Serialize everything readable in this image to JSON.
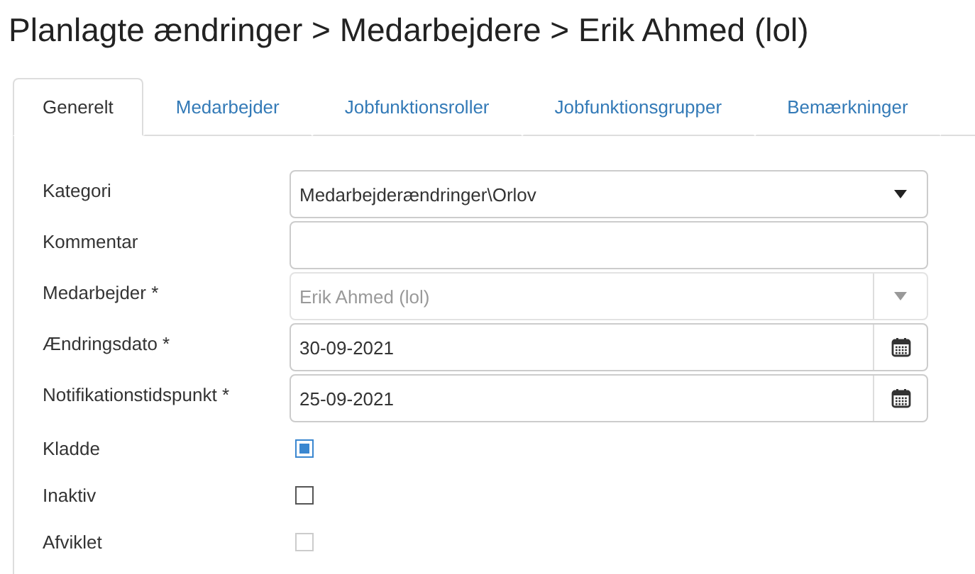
{
  "title": "Planlagte ændringer > Medarbejdere > Erik Ahmed (lol)",
  "tabs": [
    {
      "label": "Generelt",
      "selected": true
    },
    {
      "label": "Medarbejder",
      "selected": false
    },
    {
      "label": "Jobfunktionsroller",
      "selected": false
    },
    {
      "label": "Jobfunktionsgrupper",
      "selected": false
    },
    {
      "label": "Bemærkninger",
      "selected": false
    }
  ],
  "fields": [
    {
      "kind": "select",
      "label": "Kategori",
      "value": "Medarbejderændringer\\Orlov",
      "disabled": false
    },
    {
      "kind": "text",
      "label": "Kommentar",
      "disabled": false
    },
    {
      "kind": "select",
      "label": "Medarbejder *",
      "value": "Erik Ahmed (lol)",
      "disabled": true
    },
    {
      "kind": "date",
      "label": "Ændringsdato *",
      "value": "30-09-2021",
      "disabled": false
    },
    {
      "kind": "date",
      "label": "Notifikationstidspunkt *",
      "value": "25-09-2021",
      "disabled": false
    },
    {
      "kind": "checkbox",
      "label": "Kladde",
      "checked": true,
      "disabled": false
    },
    {
      "kind": "checkbox",
      "label": "Inaktiv",
      "checked": false,
      "disabled": false
    },
    {
      "kind": "checkbox",
      "label": "Afviklet",
      "checked": false,
      "disabled": true
    }
  ]
}
